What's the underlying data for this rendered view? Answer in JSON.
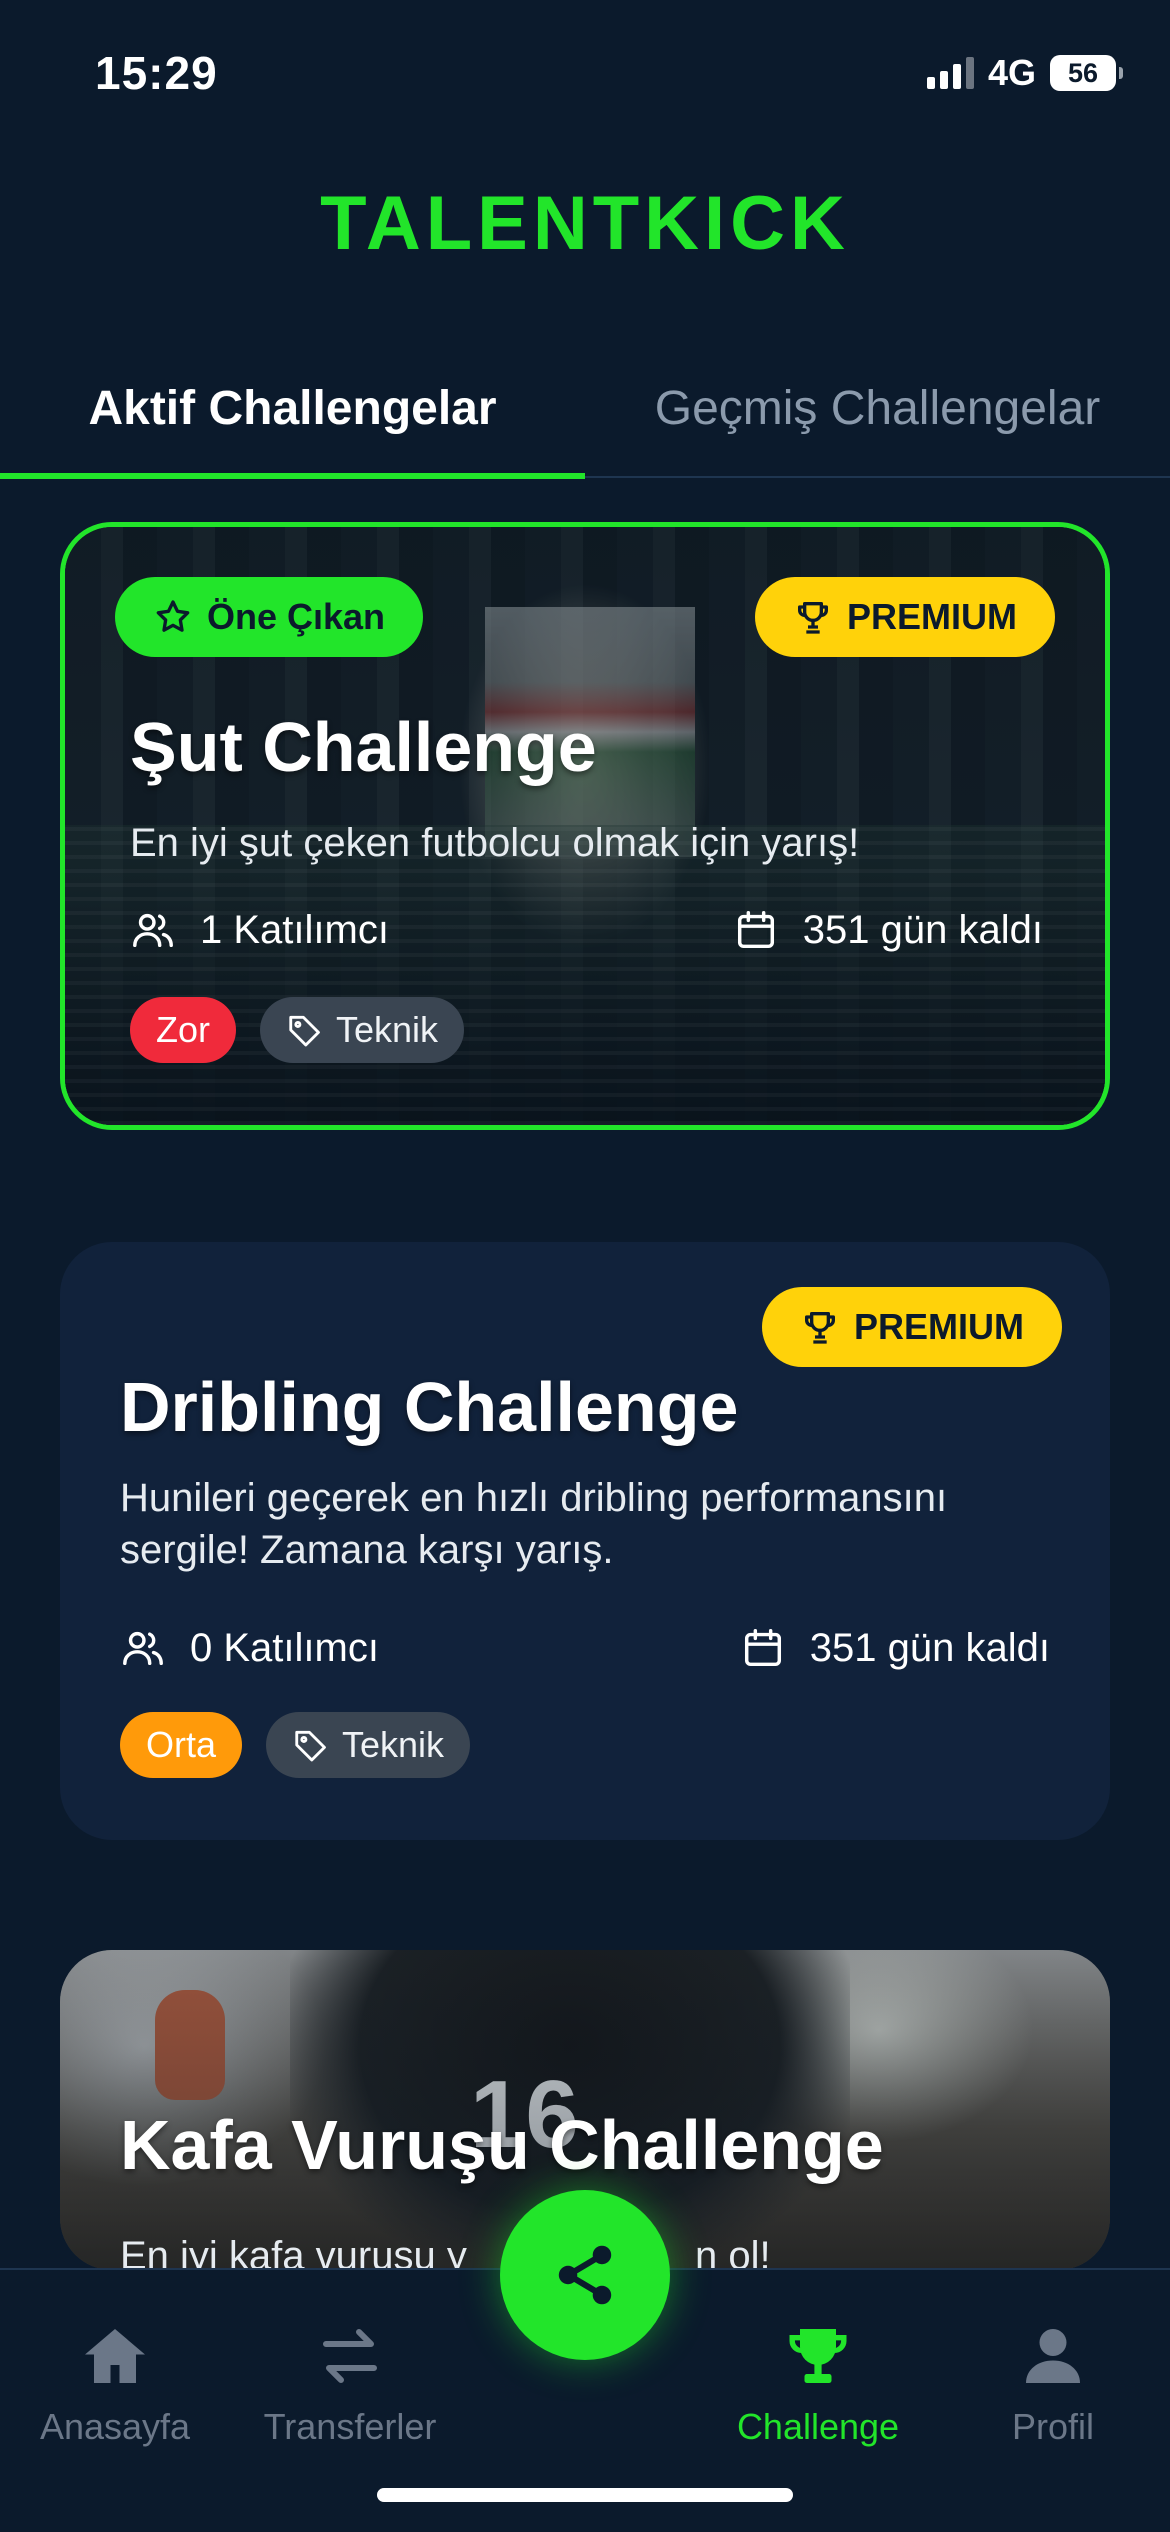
{
  "status_bar": {
    "time": "15:29",
    "network": "4G",
    "battery": "56"
  },
  "header": {
    "title": "TALENTKICK"
  },
  "tabs": [
    {
      "label": "Aktif Challengelar",
      "active": true
    },
    {
      "label": "Geçmiş Challengelar",
      "active": false
    }
  ],
  "challenges": [
    {
      "featured_label": "Öne Çıkan",
      "premium_label": "PREMIUM",
      "title": "Şut Challenge",
      "description": "En iyi şut çeken futbolcu olmak için yarış!",
      "participants": "1 Katılımcı",
      "days_left": "351 gün kaldı",
      "difficulty": "Zor",
      "category": "Teknik"
    },
    {
      "premium_label": "PREMIUM",
      "title": "Dribling Challenge",
      "description": "Hunileri geçerek en hızlı dribling performansını sergile! Zamana karşı yarış.",
      "participants": "0 Katılımcı",
      "days_left": "351 gün kaldı",
      "difficulty": "Orta",
      "category": "Teknik"
    },
    {
      "title": "Kafa Vuruşu Challenge",
      "description": "En iyi kafa vuruşu y",
      "description_tail": "n ol!",
      "jersey_number": "16"
    }
  ],
  "bottom_nav": {
    "items": [
      {
        "label": "Anasayfa",
        "icon": "home-icon"
      },
      {
        "label": "Transferler",
        "icon": "transfer-icon"
      },
      {
        "label": "Challenge",
        "icon": "trophy-icon",
        "active": true
      },
      {
        "label": "Profil",
        "icon": "profile-icon"
      }
    ],
    "fab_icon": "share-icon"
  },
  "colors": {
    "background": "#0b1a2c",
    "accent": "#22e52a",
    "premium": "#ffd20a",
    "hard": "#f02a3b",
    "medium": "#ff9a0a"
  }
}
